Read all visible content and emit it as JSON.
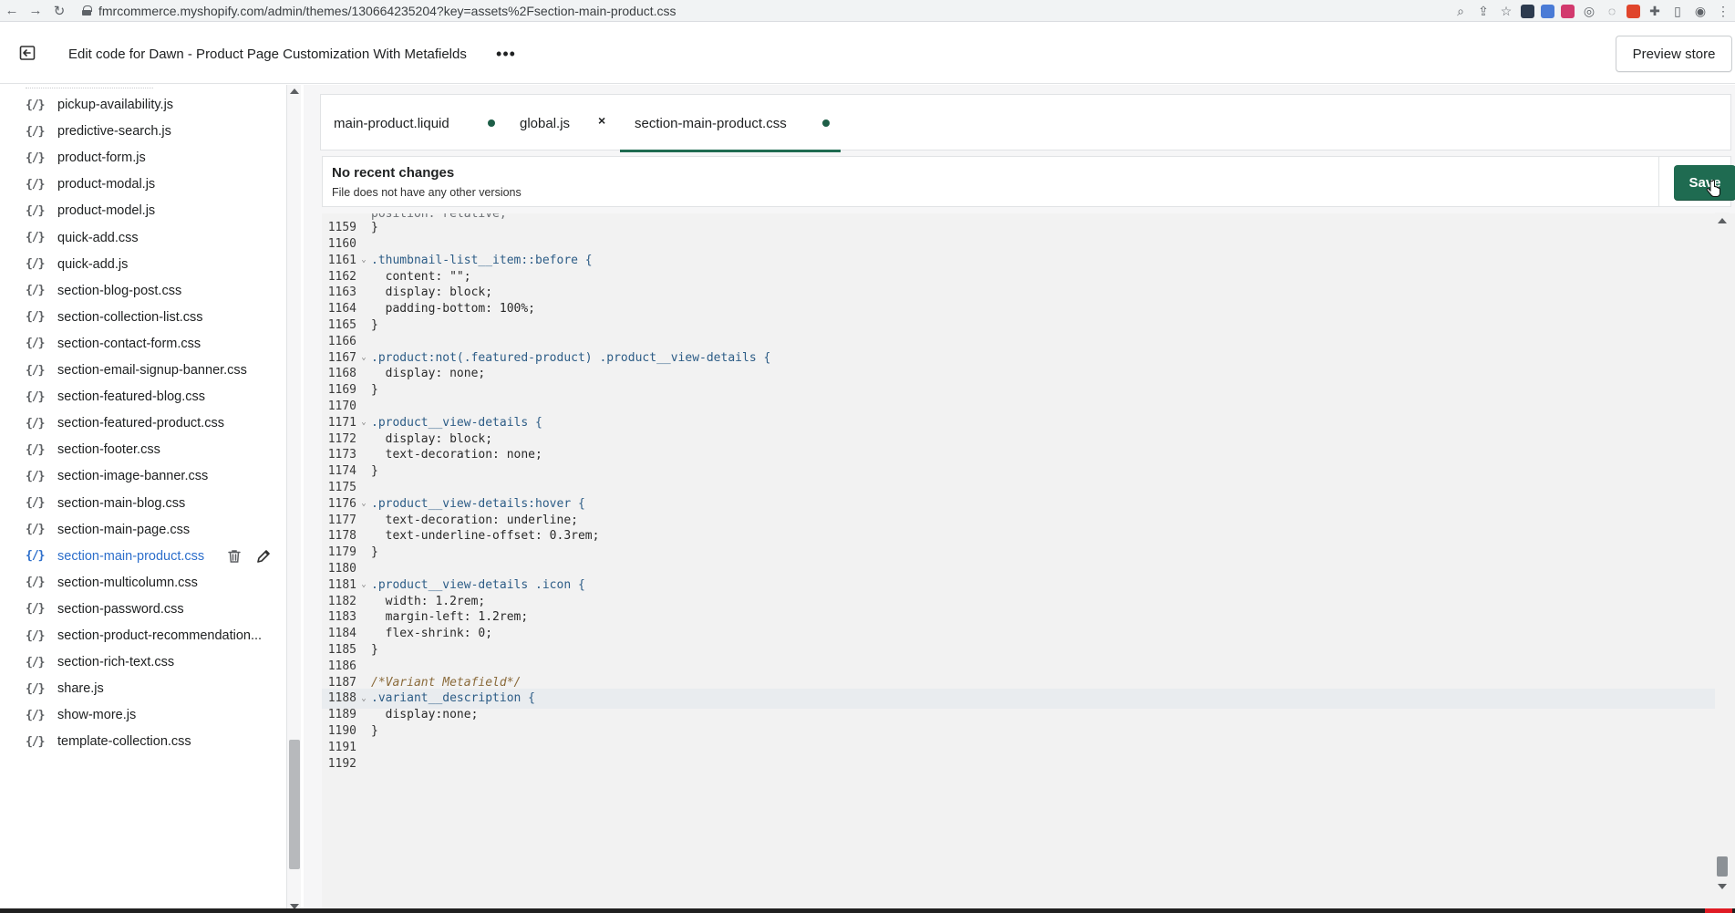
{
  "browser": {
    "url": "fmrcommerce.myshopify.com/admin/themes/130664235204?key=assets%2Fsection-main-product.css"
  },
  "header": {
    "title": "Edit code for Dawn - Product Page Customization With Metafields",
    "more_label": "•••",
    "preview_label": "Preview store"
  },
  "sidebar": {
    "files": [
      {
        "icon": "{/}",
        "name": "pickup-availability.js"
      },
      {
        "icon": "{/}",
        "name": "predictive-search.js"
      },
      {
        "icon": "{/}",
        "name": "product-form.js"
      },
      {
        "icon": "{/}",
        "name": "product-modal.js"
      },
      {
        "icon": "{/}",
        "name": "product-model.js"
      },
      {
        "icon": "{/}",
        "name": "quick-add.css"
      },
      {
        "icon": "{/}",
        "name": "quick-add.js"
      },
      {
        "icon": "{/}",
        "name": "section-blog-post.css"
      },
      {
        "icon": "{/}",
        "name": "section-collection-list.css"
      },
      {
        "icon": "{/}",
        "name": "section-contact-form.css"
      },
      {
        "icon": "{/}",
        "name": "section-email-signup-banner.css"
      },
      {
        "icon": "{/}",
        "name": "section-featured-blog.css"
      },
      {
        "icon": "{/}",
        "name": "section-featured-product.css"
      },
      {
        "icon": "{/}",
        "name": "section-footer.css"
      },
      {
        "icon": "{/}",
        "name": "section-image-banner.css"
      },
      {
        "icon": "{/}",
        "name": "section-main-blog.css"
      },
      {
        "icon": "{/}",
        "name": "section-main-page.css"
      },
      {
        "icon": "{/}",
        "name": "section-main-product.css"
      },
      {
        "icon": "{/}",
        "name": "section-multicolumn.css"
      },
      {
        "icon": "{/}",
        "name": "section-password.css"
      },
      {
        "icon": "{/}",
        "name": "section-product-recommendation..."
      },
      {
        "icon": "{/}",
        "name": "section-rich-text.css"
      },
      {
        "icon": "{/}",
        "name": "share.js"
      },
      {
        "icon": "{/}",
        "name": "show-more.js"
      },
      {
        "icon": "{/}",
        "name": "template-collection.css"
      }
    ],
    "active_index": 17
  },
  "tabs": [
    {
      "label": "main-product.liquid",
      "marker": "dot"
    },
    {
      "label": "global.js",
      "marker": "×"
    },
    {
      "label": "section-main-product.css",
      "marker": "dot",
      "active": true
    }
  ],
  "history": {
    "title": "No recent changes",
    "subtitle": "File does not have any other versions",
    "save_label": "Save"
  },
  "code": {
    "lines": [
      {
        "n": "1159",
        "text": "}"
      },
      {
        "n": "1160",
        "text": ""
      },
      {
        "n": "1161",
        "text": ".thumbnail-list__item::before {",
        "fold": true
      },
      {
        "n": "1162",
        "text": "  content: \"\";"
      },
      {
        "n": "1163",
        "text": "  display: block;"
      },
      {
        "n": "1164",
        "text": "  padding-bottom: 100%;"
      },
      {
        "n": "1165",
        "text": "}"
      },
      {
        "n": "1166",
        "text": ""
      },
      {
        "n": "1167",
        "text": ".product:not(.featured-product) .product__view-details {",
        "fold": true
      },
      {
        "n": "1168",
        "text": "  display: none;"
      },
      {
        "n": "1169",
        "text": "}"
      },
      {
        "n": "1170",
        "text": ""
      },
      {
        "n": "1171",
        "text": ".product__view-details {",
        "fold": true
      },
      {
        "n": "1172",
        "text": "  display: block;"
      },
      {
        "n": "1173",
        "text": "  text-decoration: none;"
      },
      {
        "n": "1174",
        "text": "}"
      },
      {
        "n": "1175",
        "text": ""
      },
      {
        "n": "1176",
        "text": ".product__view-details:hover {",
        "fold": true
      },
      {
        "n": "1177",
        "text": "  text-decoration: underline;"
      },
      {
        "n": "1178",
        "text": "  text-underline-offset: 0.3rem;"
      },
      {
        "n": "1179",
        "text": "}"
      },
      {
        "n": "1180",
        "text": ""
      },
      {
        "n": "1181",
        "text": ".product__view-details .icon {",
        "fold": true
      },
      {
        "n": "1182",
        "text": "  width: 1.2rem;"
      },
      {
        "n": "1183",
        "text": "  margin-left: 1.2rem;"
      },
      {
        "n": "1184",
        "text": "  flex-shrink: 0;"
      },
      {
        "n": "1185",
        "text": "}"
      },
      {
        "n": "1186",
        "text": ""
      },
      {
        "n": "1187",
        "text": "/*Variant Metafield*/"
      },
      {
        "n": "1188",
        "text": ".variant__description {",
        "fold": true,
        "current": true
      },
      {
        "n": "1189",
        "text": "  display:none;"
      },
      {
        "n": "1190",
        "text": "}"
      },
      {
        "n": "1191",
        "text": ""
      },
      {
        "n": "1192",
        "text": ""
      }
    ]
  },
  "colors": {
    "save_button": "#1f6b51",
    "active_tab_underline": "#1f6b51",
    "active_file": "#2c6ecb"
  }
}
